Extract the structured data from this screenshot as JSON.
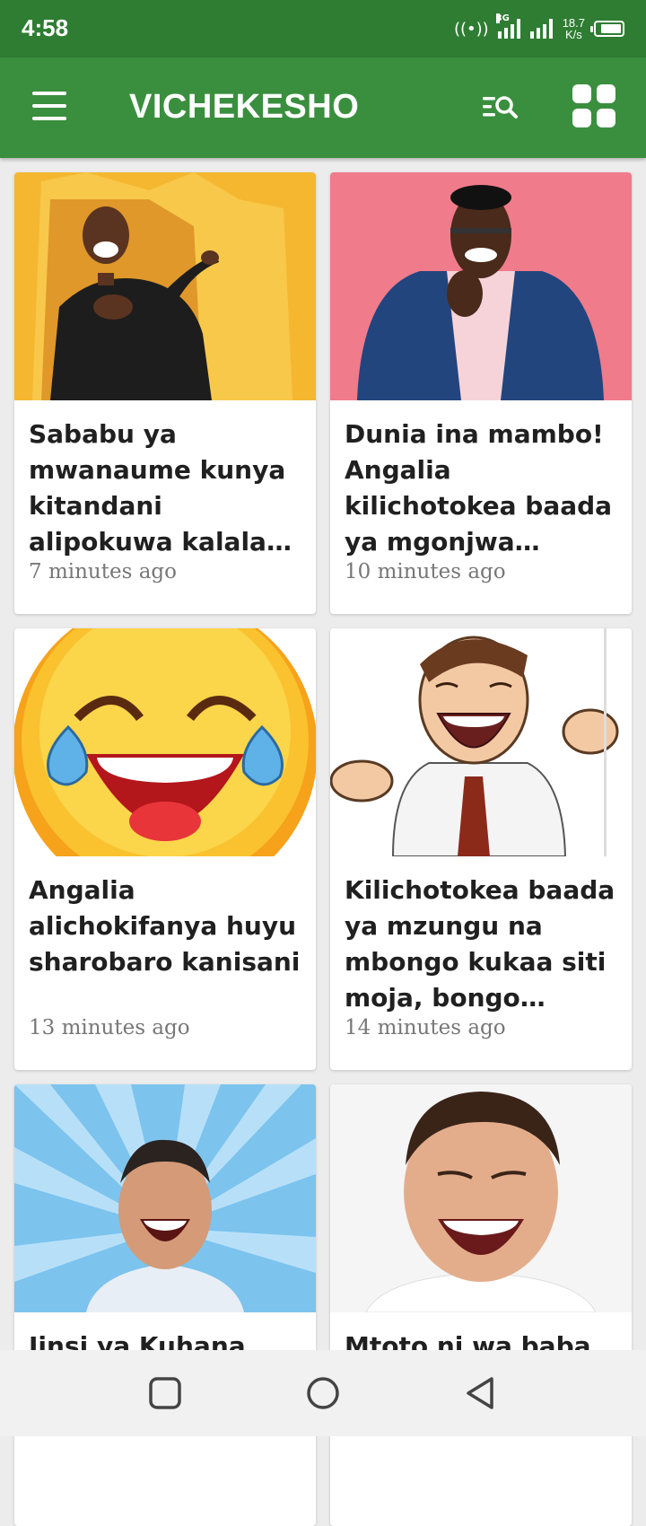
{
  "status_bar": {
    "time": "4:58",
    "network": "3G",
    "speed_value": "18.7",
    "speed_unit": "K/s",
    "icons": [
      "hotspot-icon",
      "signal-icon",
      "signal-icon",
      "battery-icon"
    ]
  },
  "app_bar": {
    "title": "VICHEKESHO",
    "icons": [
      "menu-icon",
      "search-list-icon",
      "grid-view-icon"
    ]
  },
  "articles": [
    {
      "title": "Sababu ya mwanaume kunya kitandani alipokuwa kalala na mke wake",
      "time": "7 minutes ago",
      "image": "Man in black suit pointing, bursting through yellow paper"
    },
    {
      "title": "Dunia ina mambo! Angalia kilichotokea baada ya mgonjwa kuwekewa macho ya mbwa",
      "time": "10 minutes ago",
      "image": "Laughing man in blue suit on pink background"
    },
    {
      "title": "Angalia alichokifanya huyu sharobaro kanisani",
      "time": "13 minutes ago",
      "image": "Laughing with tears emoji"
    },
    {
      "title": "Kilichotokea baada ya mzungu na mbongo kukaa siti moja, bongo wasanii wengi",
      "time": "14 minutes ago",
      "image": "Cartoon man laughing with open hands"
    },
    {
      "title": "Jinsi ya Kuhana",
      "time": "",
      "image": "Laughing man on blue sunburst background"
    },
    {
      "title": "Mtoto ni wa baba au",
      "time": "",
      "image": "Young man laughing with eyes closed"
    }
  ],
  "nav_bar": {
    "buttons": [
      "recents-button",
      "home-button",
      "back-button"
    ]
  },
  "colors": {
    "status_bar": "#2f7d33",
    "app_bar": "#3a8f3e",
    "background": "#ececec"
  }
}
